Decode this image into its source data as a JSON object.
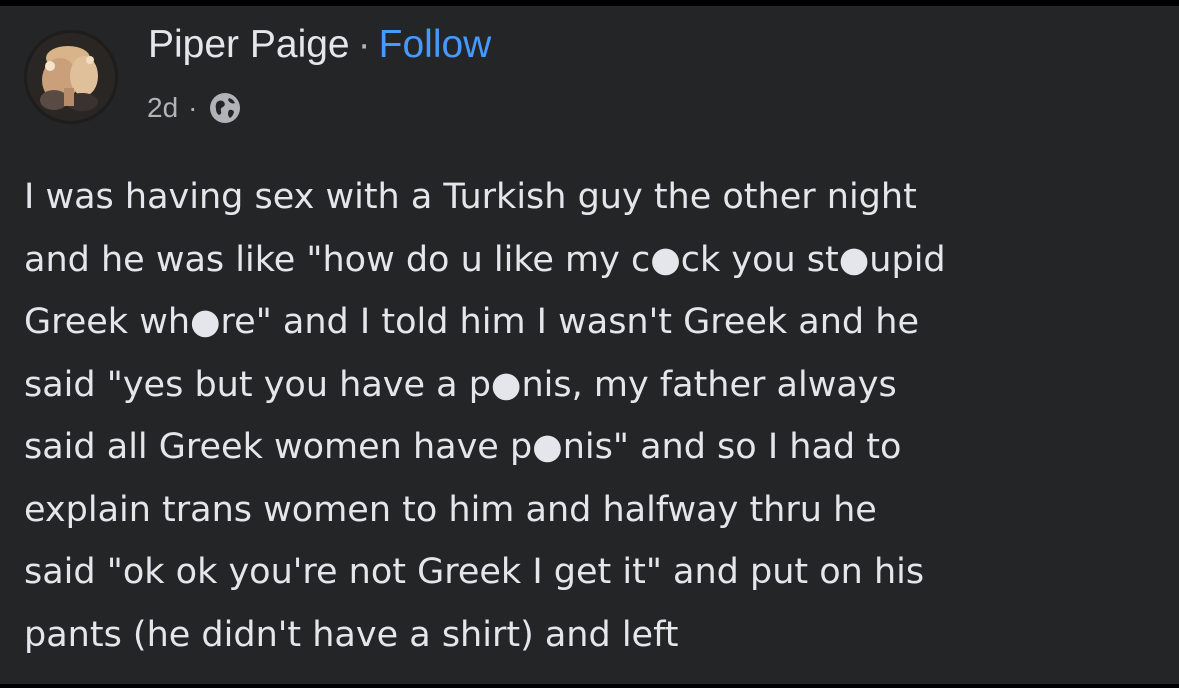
{
  "post": {
    "author_name": "Piper Paige",
    "separator": "·",
    "follow_label": "Follow",
    "timestamp": "2d",
    "meta_separator": "·",
    "audience_icon": "globe-icon",
    "avatar_icon": "profile-photo",
    "body_lines": [
      "I was having sex with a Turkish guy the other night",
      "and he was like \"how do u like my c●ck you st●upid",
      "Greek wh●re\" and I told him I wasn't Greek and he",
      "said \"yes but you have a p●nis, my father always",
      "said all Greek women have p●nis\" and so I had to",
      "explain trans women to him and halfway thru he",
      "said \"ok ok you're not Greek I get it\" and put on his",
      "pants (he didn't have a shirt) and left"
    ]
  },
  "colors": {
    "background": "#242526",
    "text_primary": "#e4e6eb",
    "text_secondary": "#b0b3b8",
    "link": "#4599ff"
  }
}
